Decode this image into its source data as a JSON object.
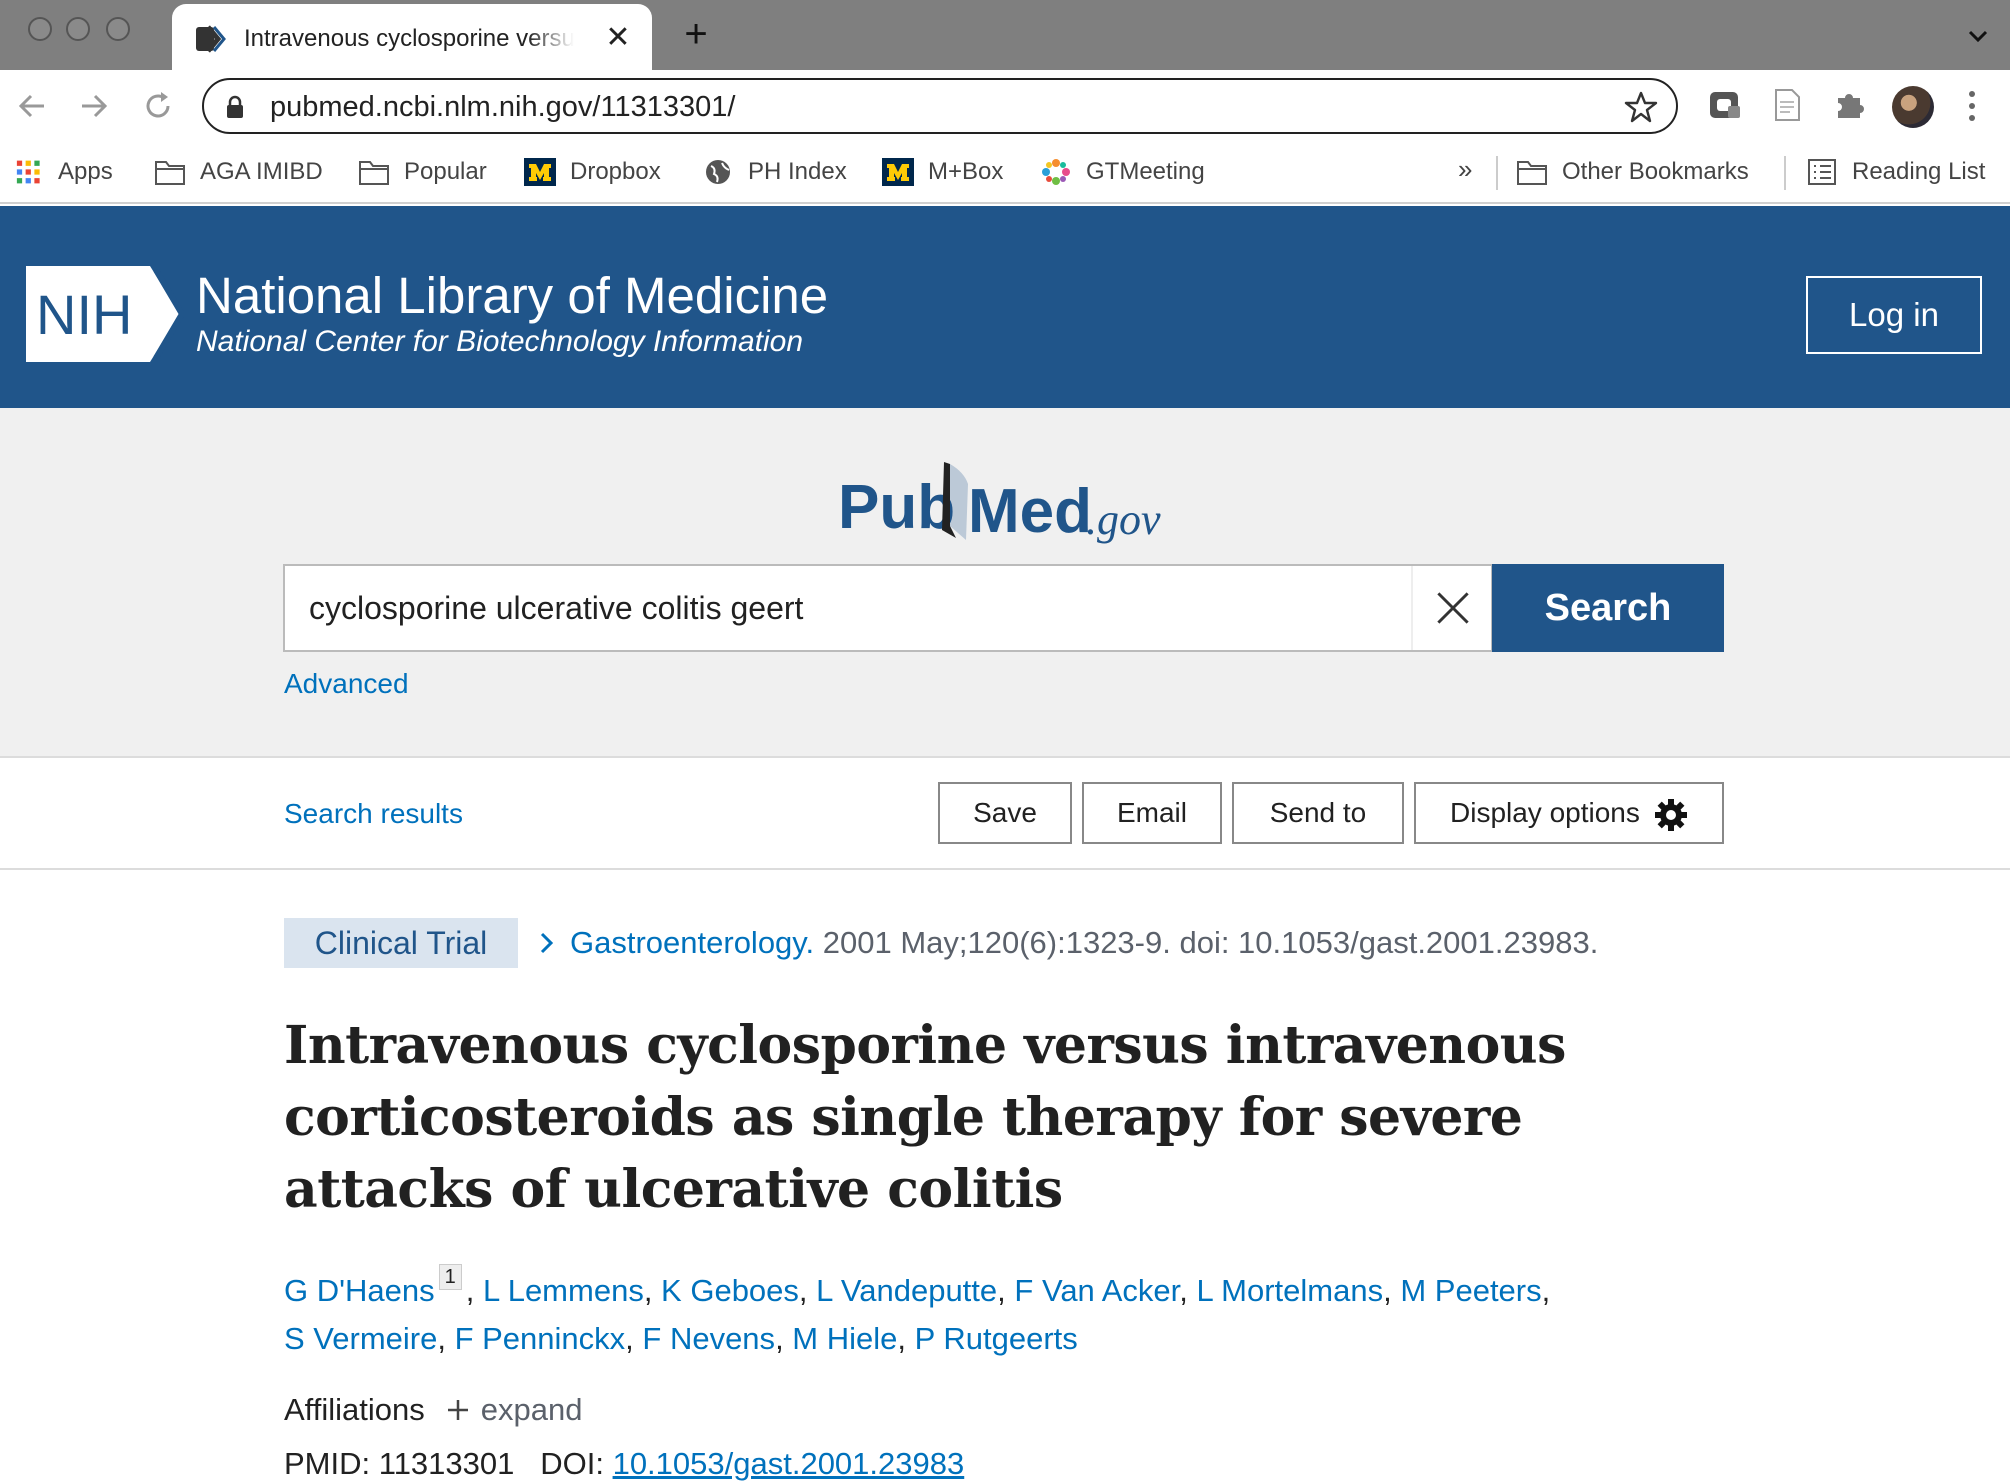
{
  "browser": {
    "tab_title": "Intravenous cyclosporine versus intravenous corticosteroids as single therapy for severe attacks of ulcerative colitis",
    "url": "pubmed.ncbi.nlm.nih.gov/11313301/",
    "bookmarks": [
      "Apps",
      "AGA IMIBD",
      "Popular",
      "Dropbox",
      "PH Index",
      "M+Box",
      "GTMeeting"
    ],
    "bookmarks_overflow": "»",
    "other_bookmarks": "Other Bookmarks",
    "reading_list": "Reading List"
  },
  "header": {
    "logo_text": "NIH",
    "title": "National Library of Medicine",
    "subtitle": "National Center for Biotechnology Information",
    "login_label": "Log in"
  },
  "search": {
    "logo_pub": "Pub",
    "logo_med": "Med",
    "logo_gov": ".gov",
    "query": "cyclosporine ulcerative colitis geert",
    "button_label": "Search",
    "advanced_label": "Advanced"
  },
  "actions": {
    "results_label": "Search results",
    "save_label": "Save",
    "email_label": "Email",
    "send_to_label": "Send to",
    "display_options_label": "Display options"
  },
  "article": {
    "type_badge": "Clinical Trial",
    "journal": "Gastroenterology.",
    "citation": " 2001 May;120(6):1323-9. doi: 10.1053/gast.2001.23983.",
    "title": "Intravenous cyclosporine versus intravenous corticosteroids as single therapy for severe attacks of ulcerative colitis",
    "authors": [
      "G D'Haens",
      "L Lemmens",
      "K Geboes",
      "L Vandeputte",
      "F Van Acker",
      "L Mortelmans",
      "M Peeters",
      "S Vermeire",
      "F Penninckx",
      "F Nevens",
      "M Hiele",
      "P Rutgeerts"
    ],
    "first_author_affiliation_ref": "1",
    "affiliations_label": "Affiliations",
    "expand_label": "expand",
    "pmid_label": "PMID:",
    "pmid": "11313301",
    "doi_label": "DOI:",
    "doi": "10.1053/gast.2001.23983"
  },
  "colors": {
    "nih_blue": "#20558a",
    "link_blue": "#0071bc",
    "badge_bg": "#dae4ef"
  }
}
